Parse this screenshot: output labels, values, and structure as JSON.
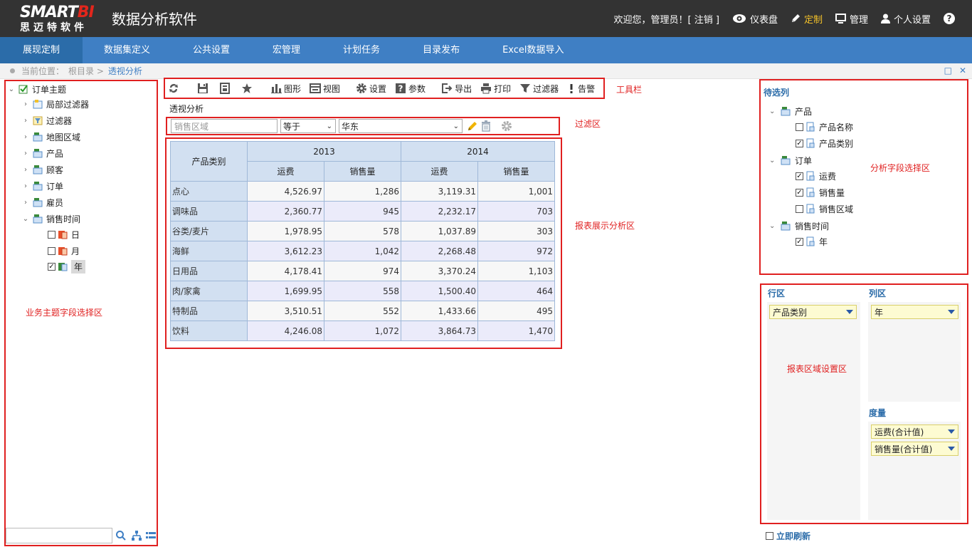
{
  "header": {
    "logo_brand_a": "SMART",
    "logo_brand_b": "BI",
    "logo_sub": "思迈特软件",
    "app_title": "数据分析软件",
    "welcome": "欢迎您，管理员！[ 注销 ]",
    "dashboard": "仪表盘",
    "customize": "定制",
    "manage": "管理",
    "personal": "个人设置",
    "help": "?"
  },
  "nav": {
    "items": [
      "展现定制",
      "数据集定义",
      "公共设置",
      "宏管理",
      "计划任务",
      "目录发布",
      "Excel数据导入"
    ]
  },
  "breadcrumb": {
    "prefix": "当前位置：",
    "root": "根目录 >",
    "current": "透视分析"
  },
  "tree": {
    "root": "订单主题",
    "items": [
      "局部过滤器",
      "过滤器",
      "地图区域",
      "产品",
      "顾客",
      "订单",
      "雇员",
      "销售时间"
    ],
    "time_children": [
      "日",
      "月",
      "年"
    ],
    "area_label": "业务主题字段选择区"
  },
  "toolbar": {
    "chart": "图形",
    "view": "视图",
    "settings": "设置",
    "params": "参数",
    "export": "导出",
    "print": "打印",
    "filter": "过滤器",
    "alert": "告警",
    "area_label": "工具栏"
  },
  "report": {
    "title": "透视分析"
  },
  "filter": {
    "field_placeholder": "销售区域",
    "operator": "等于",
    "value": "华东",
    "area_label": "过滤区"
  },
  "table": {
    "row_header": "产品类别",
    "years": [
      "2013",
      "2014"
    ],
    "measures": [
      "运费",
      "销售量"
    ],
    "rows": [
      {
        "category": "点心",
        "v": [
          "4,526.97",
          "1,286",
          "3,119.31",
          "1,001"
        ]
      },
      {
        "category": "调味品",
        "v": [
          "2,360.77",
          "945",
          "2,232.17",
          "703"
        ]
      },
      {
        "category": "谷类/麦片",
        "v": [
          "1,978.95",
          "578",
          "1,037.89",
          "303"
        ]
      },
      {
        "category": "海鲜",
        "v": [
          "3,612.23",
          "1,042",
          "2,268.48",
          "972"
        ]
      },
      {
        "category": "日用品",
        "v": [
          "4,178.41",
          "974",
          "3,370.24",
          "1,103"
        ]
      },
      {
        "category": "肉/家禽",
        "v": [
          "1,699.95",
          "558",
          "1,500.40",
          "464"
        ]
      },
      {
        "category": "特制品",
        "v": [
          "3,510.51",
          "552",
          "1,433.66",
          "495"
        ]
      },
      {
        "category": "饮料",
        "v": [
          "4,246.08",
          "1,072",
          "3,864.73",
          "1,470"
        ]
      }
    ],
    "area_label": "报表展示分析区"
  },
  "candidates": {
    "title": "待选列",
    "product": "产品",
    "product_name": "产品名称",
    "product_category": "产品类别",
    "order": "订单",
    "freight": "运费",
    "sales_qty": "销售量",
    "sales_region": "销售区域",
    "sales_time": "销售时间",
    "year": "年",
    "area_label": "分析字段选择区"
  },
  "settings": {
    "row_zone": "行区",
    "col_zone": "列区",
    "measure_zone": "度量",
    "row_chip": "产品类别",
    "col_chip": "年",
    "measure_chips": [
      "运费(合计值)",
      "销售量(合计值)"
    ],
    "area_label": "报表区域设置区"
  },
  "refresh": {
    "label": "立即刷新"
  },
  "colors": {
    "nav_bg": "#3f7fc4",
    "nav_active": "#2b6ca9",
    "header_bg": "#333333",
    "annotation_red": "#e02020"
  }
}
